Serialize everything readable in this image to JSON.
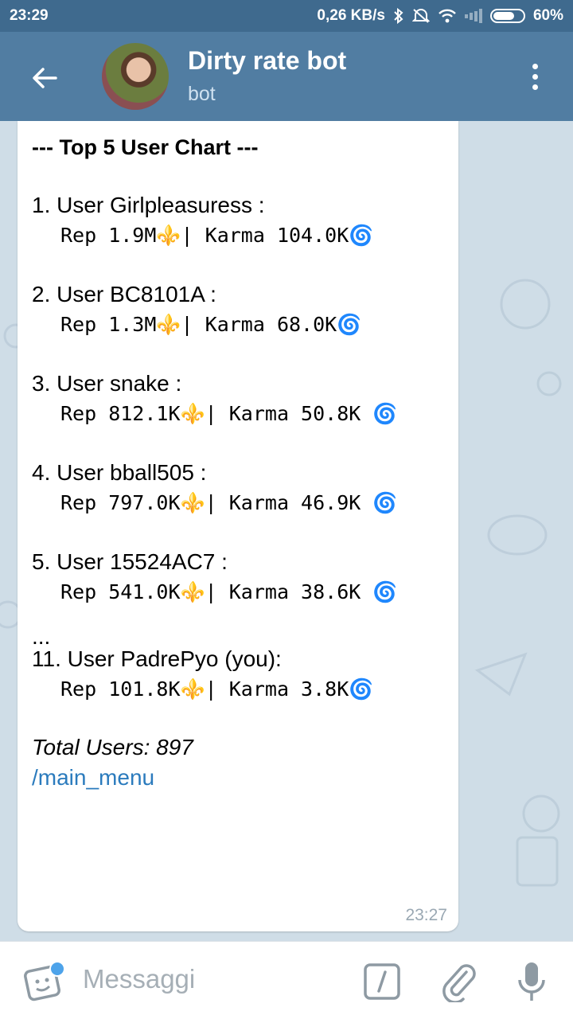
{
  "status_bar": {
    "time": "23:29",
    "speed": "0,26 KB/s",
    "battery": "60%"
  },
  "header": {
    "title": "Dirty rate bot",
    "subtitle": "bot"
  },
  "message": {
    "title": "--- Top 5 User Chart ---",
    "entries": [
      {
        "user": "1. User Girlpleasuress :",
        "stats": "Rep 1.9M⚜️| Karma 104.0K🌀"
      },
      {
        "user": "2. User BC8101A :",
        "stats": "Rep 1.3M⚜️| Karma 68.0K🌀"
      },
      {
        "user": "3. User snake :",
        "stats": "Rep 812.1K⚜️| Karma 50.8K 🌀"
      },
      {
        "user": "4. User bball505 :",
        "stats": "Rep 797.0K⚜️| Karma 46.9K 🌀"
      },
      {
        "user": "5. User 15524AC7 :",
        "stats": "Rep 541.0K⚜️| Karma 38.6K 🌀"
      }
    ],
    "ellipsis": "...",
    "you": {
      "user": "11. User PadrePyo (you):",
      "stats": "Rep 101.8K⚜️| Karma 3.8K🌀"
    },
    "total": "Total Users: 897",
    "link": "/main_menu",
    "time": "23:27"
  },
  "input": {
    "placeholder": "Messaggi"
  },
  "icons": [
    "back-arrow-icon",
    "more-vert-icon",
    "bluetooth-icon",
    "mute-icon",
    "wifi-icon",
    "signal-icon",
    "battery-icon",
    "sticker-icon",
    "slash-command-icon",
    "paperclip-icon",
    "microphone-icon"
  ],
  "colors": {
    "header": "#517da2",
    "status_bar": "#3f6a8e",
    "link": "#2b7bbd",
    "chat_bg": "#cfdde7"
  }
}
